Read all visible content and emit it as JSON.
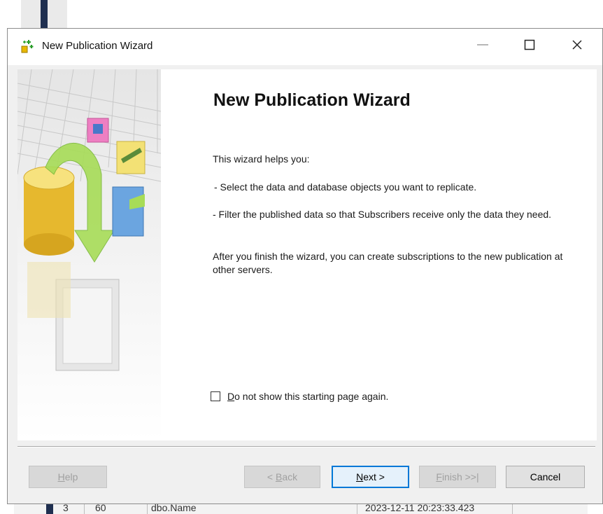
{
  "background": {
    "row": {
      "number": "3",
      "col2": "60",
      "name": "dbo.Name",
      "timestamp": "2023-12-11 20:23:33.423"
    }
  },
  "window": {
    "title": "New Publication Wizard",
    "controls": {
      "minimize": "—",
      "maximize": "☐",
      "close": "✕"
    }
  },
  "page": {
    "heading": "New Publication Wizard",
    "intro": "This wizard helps you:",
    "bullet1": "- Select the data and database objects you want to replicate.",
    "bullet2": "- Filter the published data so that Subscribers receive only the data they need.",
    "after": "After you finish the wizard, you can create subscriptions to the new publication at other servers.",
    "checkbox": {
      "mnemonic": "D",
      "label_rest": "o not show this starting page again.",
      "checked": false
    }
  },
  "buttons": {
    "help": {
      "mnemonic": "H",
      "rest": "elp",
      "enabled": false
    },
    "back": {
      "prefix": "< ",
      "mnemonic": "B",
      "rest": "ack",
      "enabled": false
    },
    "next": {
      "mnemonic": "N",
      "rest": "ext >",
      "enabled": true
    },
    "finish": {
      "mnemonic": "F",
      "rest": "inish >>|",
      "enabled": false
    },
    "cancel": {
      "label": "Cancel",
      "enabled": true
    }
  },
  "icons": {
    "app": "wizard-icon",
    "art": "replication-illustration"
  }
}
